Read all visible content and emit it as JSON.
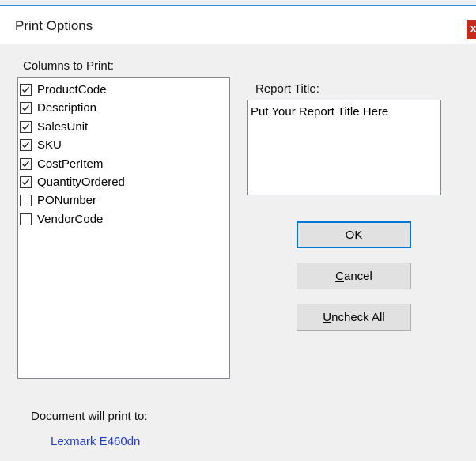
{
  "window": {
    "title": "Print Options",
    "close_label": "x"
  },
  "columns": {
    "label": "Columns to Print:",
    "items": [
      {
        "label": "ProductCode",
        "checked": true
      },
      {
        "label": "Description",
        "checked": true
      },
      {
        "label": "SalesUnit",
        "checked": true
      },
      {
        "label": "SKU",
        "checked": true
      },
      {
        "label": "CostPerItem",
        "checked": true
      },
      {
        "label": "QuantityOrdered",
        "checked": true
      },
      {
        "label": "PONumber",
        "checked": false
      },
      {
        "label": "VendorCode",
        "checked": false
      }
    ]
  },
  "report_title": {
    "label": "Report Title:",
    "value": "Put Your Report Title Here"
  },
  "buttons": {
    "ok": {
      "mnemonic": "O",
      "rest": "K"
    },
    "cancel": {
      "mnemonic": "C",
      "rest": "ancel"
    },
    "uncheck_all": {
      "mnemonic": "U",
      "rest": "ncheck All"
    }
  },
  "footer": {
    "label": "Document will print to:",
    "printer": "Lexmark E460dn"
  },
  "colors": {
    "accent": "#0078d7",
    "close": "#c42b1c",
    "printer_link": "#1f3bd0"
  }
}
